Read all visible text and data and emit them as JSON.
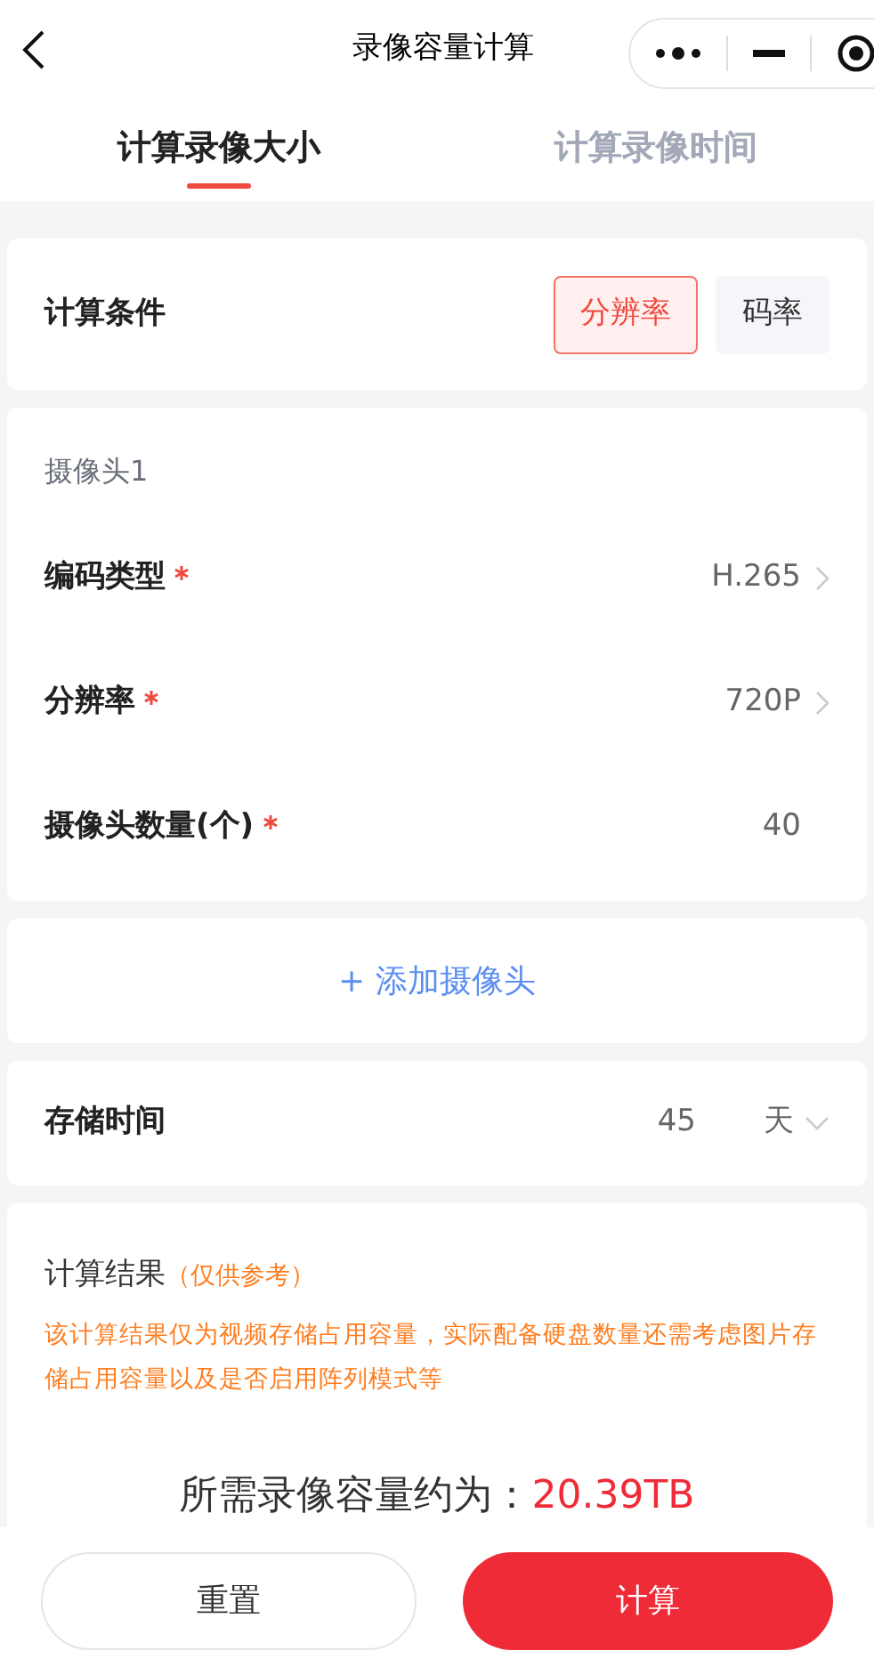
{
  "header": {
    "title": "录像容量计算"
  },
  "tabs": [
    {
      "label": "计算录像大小",
      "selected": true
    },
    {
      "label": "计算录像时间",
      "selected": false
    }
  ],
  "condition": {
    "label": "计算条件",
    "options": [
      {
        "label": "分辨率",
        "selected": true
      },
      {
        "label": "码率",
        "selected": false
      }
    ]
  },
  "camera": {
    "title": "摄像头1",
    "fields": [
      {
        "kind": "select",
        "label": "编码类型",
        "required": true,
        "value": "H.265"
      },
      {
        "kind": "select",
        "label": "分辨率",
        "required": true,
        "value": "720P"
      },
      {
        "kind": "input",
        "label": "摄像头数量(个)",
        "required": true,
        "value": "40"
      }
    ]
  },
  "add_camera": {
    "icon": "+",
    "label": "添加摄像头"
  },
  "storage": {
    "label": "存储时间",
    "value": "45",
    "unit": "天"
  },
  "result": {
    "title": "计算结果",
    "note": "（仅供参考）",
    "warning": "该计算结果仅为视频存储占用容量，实际配备硬盘数量还需考虑图片存储占用容量以及是否启用阵列模式等",
    "label": "所需录像容量约为：",
    "value": "20.39TB"
  },
  "buttons": [
    {
      "kind": "secondary",
      "label": "重置"
    },
    {
      "kind": "primary",
      "label": "计算"
    }
  ]
}
